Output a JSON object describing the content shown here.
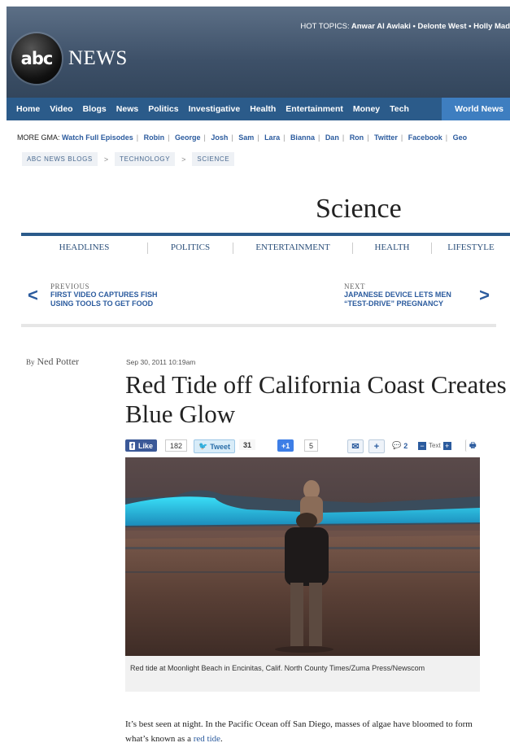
{
  "header": {
    "hot_topics_label": "HOT TOPICS:",
    "hot_topics": "Anwar Al Awlaki • Delonte West • Holly Mad",
    "logo_abc": "abc",
    "logo_news": "NEWS"
  },
  "nav": {
    "items": [
      "Home",
      "Video",
      "Blogs",
      "News",
      "Politics",
      "Investigative",
      "Health",
      "Entertainment",
      "Money",
      "Tech"
    ],
    "active": "World News"
  },
  "more_gma": {
    "label": "MORE GMA:",
    "links": [
      "Watch Full Episodes",
      "Robin",
      "George",
      "Josh",
      "Sam",
      "Lara",
      "Bianna",
      "Dan",
      "Ron",
      "Twitter",
      "Facebook",
      "Geo"
    ]
  },
  "breadcrumb": [
    "ABC NEWS BLOGS",
    "TECHNOLOGY",
    "SCIENCE"
  ],
  "section": {
    "title": "Science",
    "subnav": [
      "HEADLINES",
      "POLITICS",
      "ENTERTAINMENT",
      "HEALTH",
      "LIFESTYLE"
    ]
  },
  "prevnext": {
    "prev_kicker": "PREVIOUS",
    "prev_title": "FIRST VIDEO CAPTURES FISH USING TOOLS TO GET FOOD",
    "next_kicker": "NEXT",
    "next_title": "JAPANESE DEVICE LETS MEN “TEST-DRIVE” PREGNANCY"
  },
  "article": {
    "by": "By",
    "author": "Ned Potter",
    "date": "Sep 30, 2011 10:19am",
    "headline": "Red Tide off California Coast Creates Blue Glow",
    "caption": "Red tide at Moonlight Beach in Encinitas, Calif. North County Times/Zuma Press/Newscom",
    "body_before": "It’s best seen at night.  In the Pacific Ocean off San Diego, masses of algae have bloomed to form what’s known as a ",
    "body_link": "red tide",
    "body_after": "."
  },
  "share": {
    "like_label": "Like",
    "like_count": "182",
    "tweet_label": "Tweet",
    "tweet_count": "31",
    "plusone_label": "+1",
    "plusone_count": "5",
    "comments_count": "2",
    "text_label": "Text"
  },
  "colors": {
    "nav_bg": "#2b5b8a",
    "nav_active": "#3e7ec0",
    "link_blue": "#2b5b9e",
    "facebook": "#3b5998"
  }
}
